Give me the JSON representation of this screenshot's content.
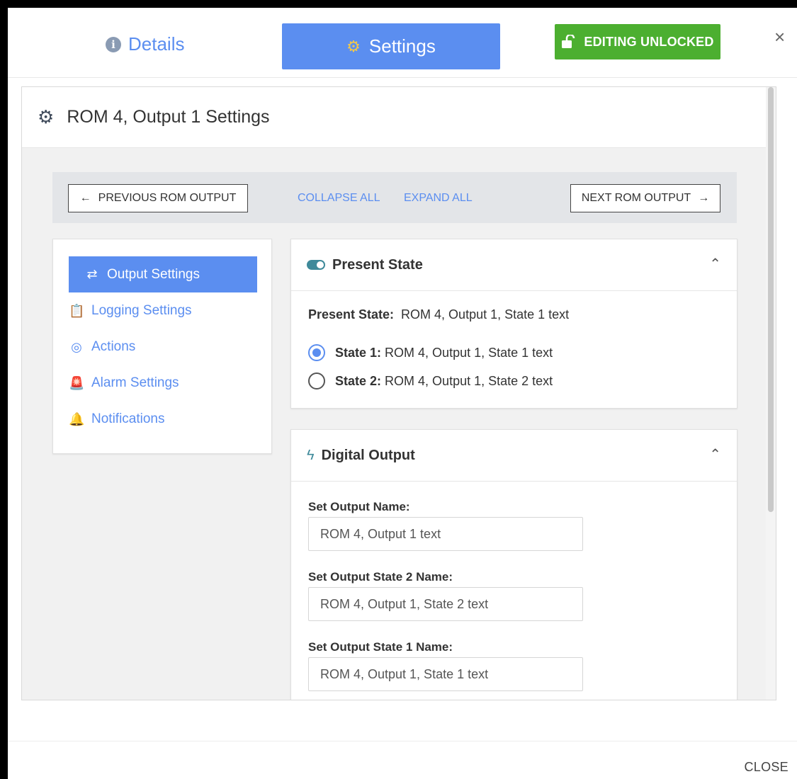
{
  "tabs": {
    "details_label": "Details",
    "details_icon": "info-icon",
    "settings_label": "Settings",
    "settings_icon": "gear-icon"
  },
  "edit_button": {
    "label": "EDITING UNLOCKED",
    "icon": "unlock-icon",
    "color": "#4caf30"
  },
  "close_icon": "×",
  "panel": {
    "title": "ROM 4, Output 1 Settings"
  },
  "nav": {
    "prev_label": "PREVIOUS ROM OUTPUT",
    "next_label": "NEXT ROM OUTPUT",
    "collapse_label": "COLLAPSE ALL",
    "expand_label": "EXPAND ALL"
  },
  "sidebar": {
    "items": [
      {
        "label": "Output Settings",
        "icon": "output-icon",
        "active": true
      },
      {
        "label": "Logging Settings",
        "icon": "clipboard-icon",
        "active": false
      },
      {
        "label": "Actions",
        "icon": "target-icon",
        "active": false
      },
      {
        "label": "Alarm Settings",
        "icon": "alarm-icon",
        "active": false
      },
      {
        "label": "Notifications",
        "icon": "bell-icon",
        "active": false
      }
    ]
  },
  "present_state": {
    "title": "Present State",
    "label": "Present State:",
    "value": "ROM 4, Output 1, State 1 text",
    "options": [
      {
        "label": "State 1:",
        "text": "ROM 4, Output 1, State 1 text",
        "checked": true
      },
      {
        "label": "State 2:",
        "text": "ROM 4, Output 1, State 2 text",
        "checked": false
      }
    ]
  },
  "digital_output": {
    "title": "Digital Output",
    "fields": [
      {
        "label": "Set Output Name:",
        "value": "ROM 4, Output 1 text"
      },
      {
        "label": "Set Output State 2 Name:",
        "value": "ROM 4, Output 1, State 2 text"
      },
      {
        "label": "Set Output State 1 Name:",
        "value": "ROM 4, Output 1, State 1 text"
      }
    ]
  },
  "footer": {
    "close_label": "CLOSE"
  },
  "colors": {
    "accent": "#5b8ef0",
    "success": "#4caf30",
    "toggle": "#3f8a9a"
  }
}
